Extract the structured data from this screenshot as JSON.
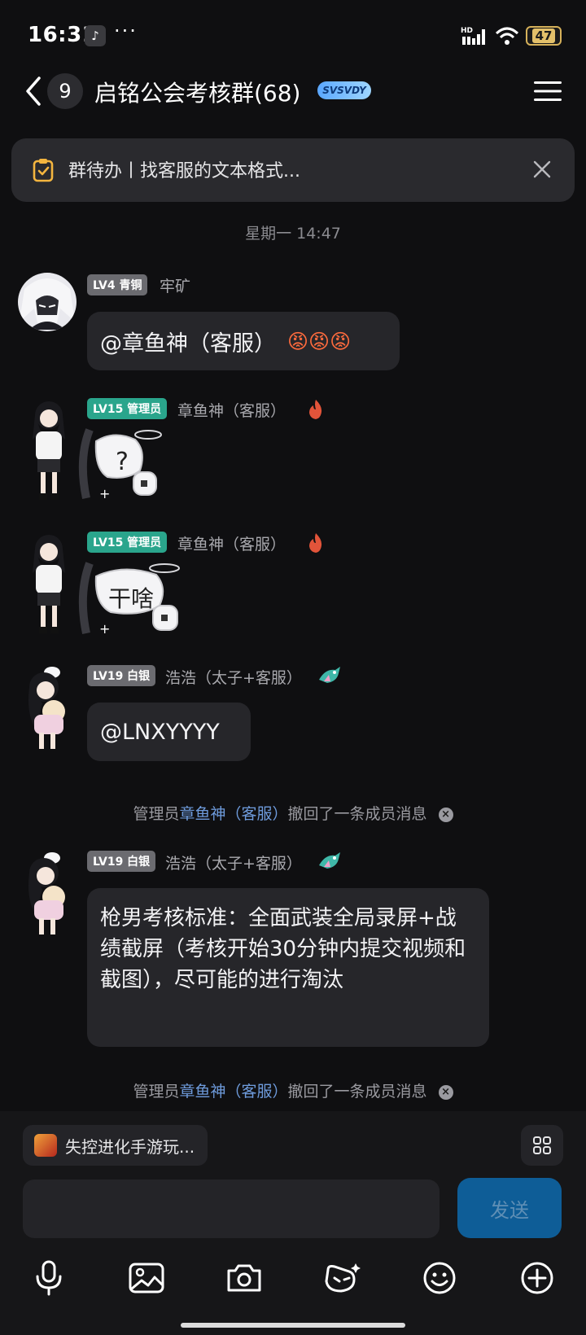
{
  "status_bar": {
    "time": "16:31",
    "app_icon_glyph": "♪",
    "more": "···",
    "network_label": "HD",
    "battery": "47"
  },
  "header": {
    "unread_count": "9",
    "title": "启铭公会考核群(68)",
    "title_badge": "SVSVDY"
  },
  "todo": {
    "text": "群待办丨找客服的文本格式..."
  },
  "date_separator": "星期一 14:47",
  "messages": [
    {
      "level": "LV4 青铜",
      "sender": "牢矿",
      "text": "@章鱼神（客服）",
      "emoji": "😡😡😡"
    },
    {
      "level": "LV15 管理员",
      "sender": "章鱼神（客服）",
      "sticker_text": "?"
    },
    {
      "level": "LV15 管理员",
      "sender": "章鱼神（客服）",
      "sticker_text": "干啥"
    },
    {
      "level": "LV19 白银",
      "sender": "浩浩（太子+客服）",
      "text": "@LNXYYYY"
    },
    {
      "level": "LV19 白银",
      "sender": "浩浩（太子+客服）",
      "text": "枪男考核标准：全面武装全局录屏+战绩截屏（考核开始30分钟内提交视频和截图），尽可能的进行淘汰"
    }
  ],
  "system_messages": [
    {
      "prefix": "管理员",
      "link": "章鱼神（客服）",
      "suffix": "撤回了一条成员消息"
    },
    {
      "prefix": "管理员",
      "link": "章鱼神（客服）",
      "suffix": "撤回了一条成员消息"
    }
  ],
  "composer": {
    "game_chip": "失控进化手游玩...",
    "input_value": "",
    "input_placeholder": "",
    "send_label": "发送"
  },
  "toolbar_icons": [
    "microphone-icon",
    "image-icon",
    "camera-icon",
    "ai-bot-icon",
    "smile-icon",
    "plus-icon"
  ],
  "colors": {
    "background": "#0f0f11",
    "bubble": "#26262a",
    "admin_tag": "#2aa58c",
    "level_tag": "#6b6b70",
    "send_button": "#0e5d97",
    "link": "#6e9bdc",
    "fire_badge": "#e2543a"
  }
}
